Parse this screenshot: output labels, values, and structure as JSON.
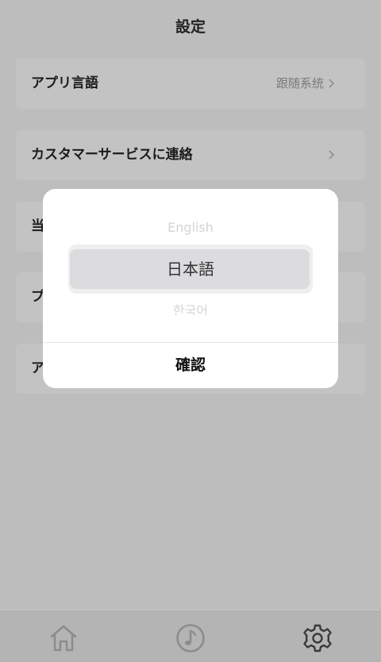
{
  "header": {
    "title": "設定"
  },
  "settings": {
    "app_language": {
      "label": "アプリ言語",
      "value": "跟随系统"
    },
    "customer_service": {
      "label": "カスタマーサービスに連絡"
    },
    "row3": {
      "label": "当"
    },
    "row4": {
      "label": "プ"
    },
    "row5": {
      "label": "ア"
    }
  },
  "language_picker": {
    "options": [
      "English",
      "日本語",
      "한국어"
    ],
    "selected": "日本語",
    "confirm_label": "確認"
  },
  "tabbar": {
    "tabs": [
      {
        "name": "home",
        "icon": "home-icon"
      },
      {
        "name": "music",
        "icon": "music-note-icon"
      },
      {
        "name": "settings",
        "icon": "gear-icon",
        "active": true
      }
    ]
  },
  "colors": {
    "overlay_background": "#bdbdbd",
    "dialog_background": "#ffffff",
    "selected_highlight": "#dcdcdf"
  }
}
